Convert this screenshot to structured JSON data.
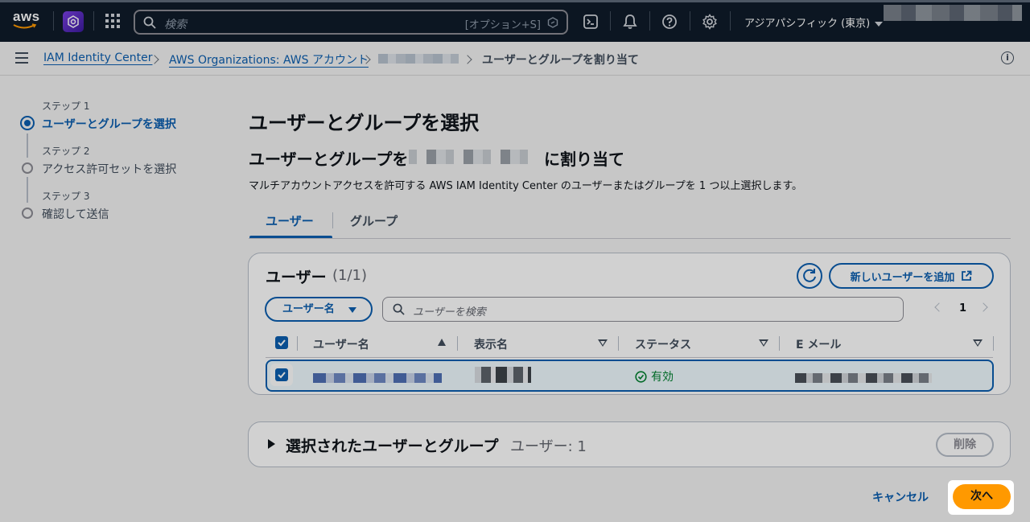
{
  "topnav": {
    "logo_text": "aws",
    "search_placeholder": "検索",
    "search_shortcut": "[オプション+S]",
    "region": "アジアパシフィック (東京)"
  },
  "breadcrumb": {
    "items": [
      "IAM Identity Center",
      "AWS Organizations: AWS アカウント"
    ],
    "current": "ユーザーとグループを割り当て"
  },
  "steps": [
    {
      "label": "ステップ 1",
      "title": "ユーザーとグループを選択"
    },
    {
      "label": "ステップ 2",
      "title": "アクセス許可セットを選択"
    },
    {
      "label": "ステップ 3",
      "title": "確認して送信"
    }
  ],
  "main": {
    "title": "ユーザーとグループを選択",
    "subtitle_prefix": "ユーザーとグループを",
    "subtitle_suffix": "に割り当て",
    "description": "マルチアカウントアクセスを許可する AWS IAM Identity Center のユーザーまたはグループを 1 つ以上選択します。",
    "tabs": [
      "ユーザー",
      "グループ"
    ]
  },
  "users_panel": {
    "title": "ユーザー",
    "count": "(1/1)",
    "add_button": "新しいユーザーを追加",
    "filter_property": "ユーザー名",
    "search_placeholder": "ユーザーを検索",
    "page": "1",
    "columns": [
      "ユーザー名",
      "表示名",
      "ステータス",
      "E メール"
    ],
    "rows": [
      {
        "status": "有効"
      }
    ]
  },
  "selected_section": {
    "title": "選択されたユーザーとグループ",
    "count": "ユーザー: 1",
    "delete_button": "削除"
  },
  "footer": {
    "cancel": "キャンセル",
    "next": "次へ"
  },
  "colors": {
    "accent": "#0b5fb0",
    "primary_button": "#ff9900",
    "success": "#00802f",
    "nav_bg": "#0f1b2a"
  }
}
